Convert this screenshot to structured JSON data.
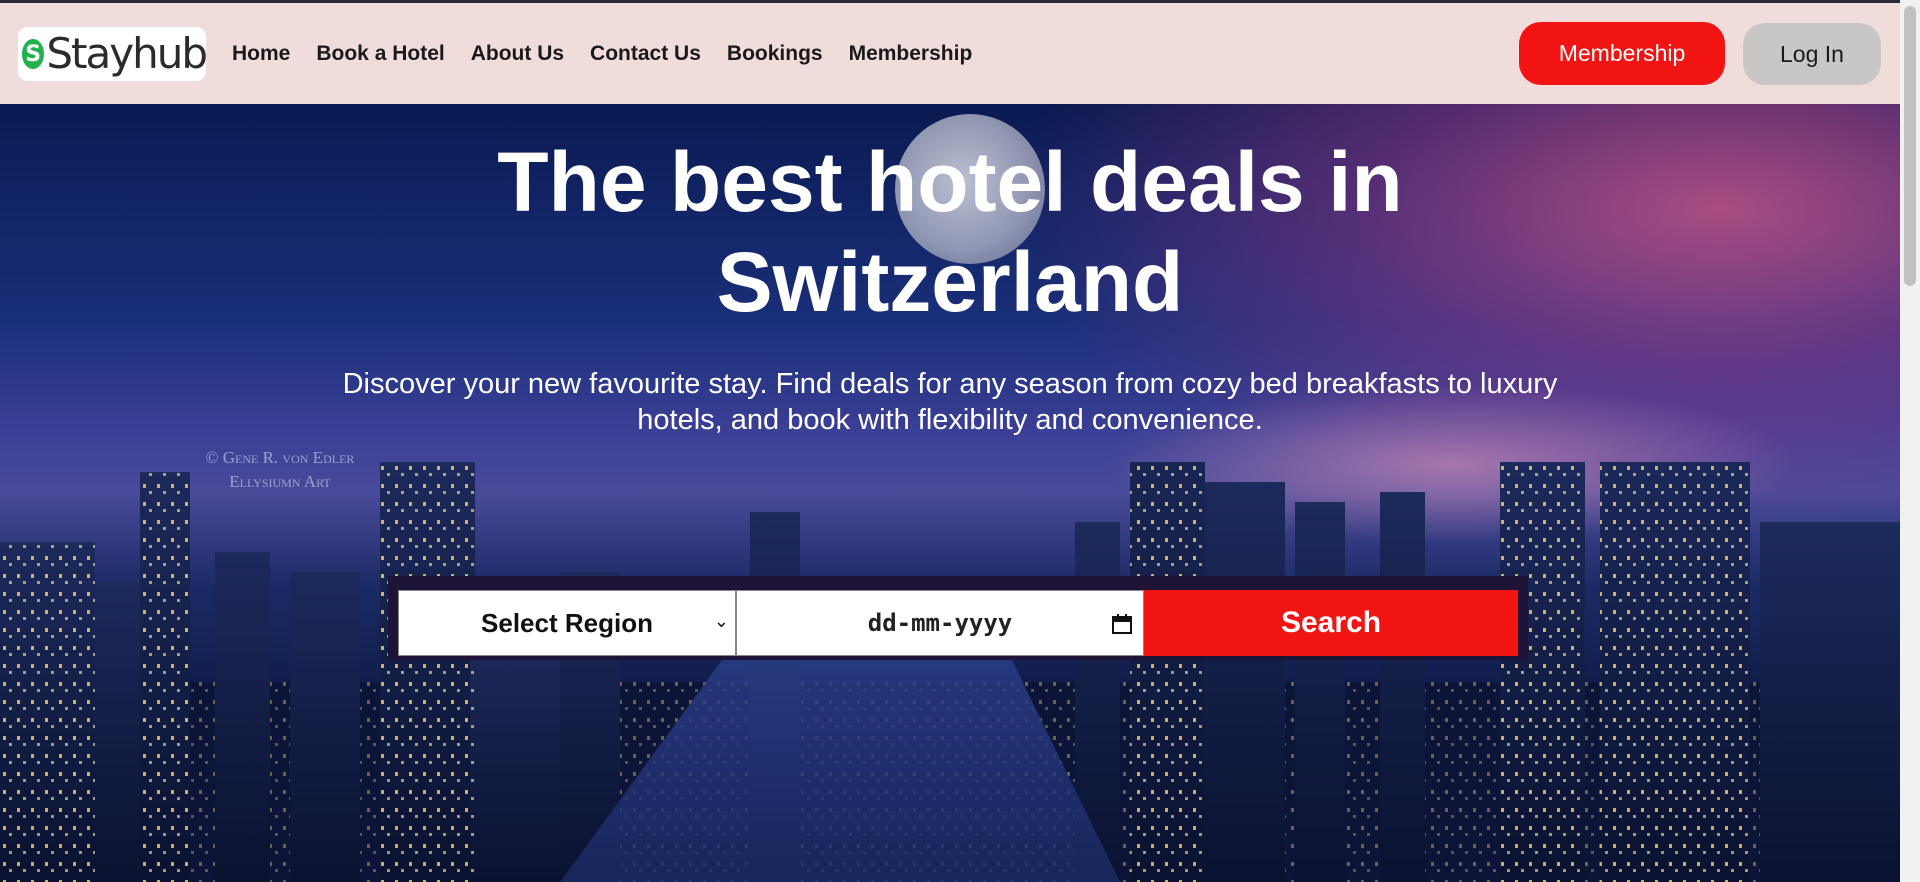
{
  "brand": {
    "name": "Stayhub",
    "badge": "S",
    "logo_color": "#22b14c"
  },
  "nav": {
    "items": [
      {
        "label": "Home"
      },
      {
        "label": "Book a Hotel"
      },
      {
        "label": "About Us"
      },
      {
        "label": "Contact Us"
      },
      {
        "label": "Bookings"
      },
      {
        "label": "Membership"
      }
    ]
  },
  "header": {
    "membership_button": "Membership",
    "login_button": "Log In",
    "accent_color": "#f21313",
    "background_color": "#f1dcdc"
  },
  "hero": {
    "title_line1": "The best hotel deals in",
    "title_line2": "Switzerland",
    "subtitle": "Discover your new favourite stay. Find deals for any season from cozy bed breakfasts to luxury hotels, and book with flexibility and convenience.",
    "watermark_line1": "© Gene R. von Edler",
    "watermark_line2": "Ellysiumn Art"
  },
  "search": {
    "region_select": "Select Region",
    "date_placeholder": "dd-mm-yyyy",
    "search_button": "Search"
  },
  "icons": {
    "region_dropdown": "chevron-down-icon",
    "date_picker": "calendar-icon"
  }
}
